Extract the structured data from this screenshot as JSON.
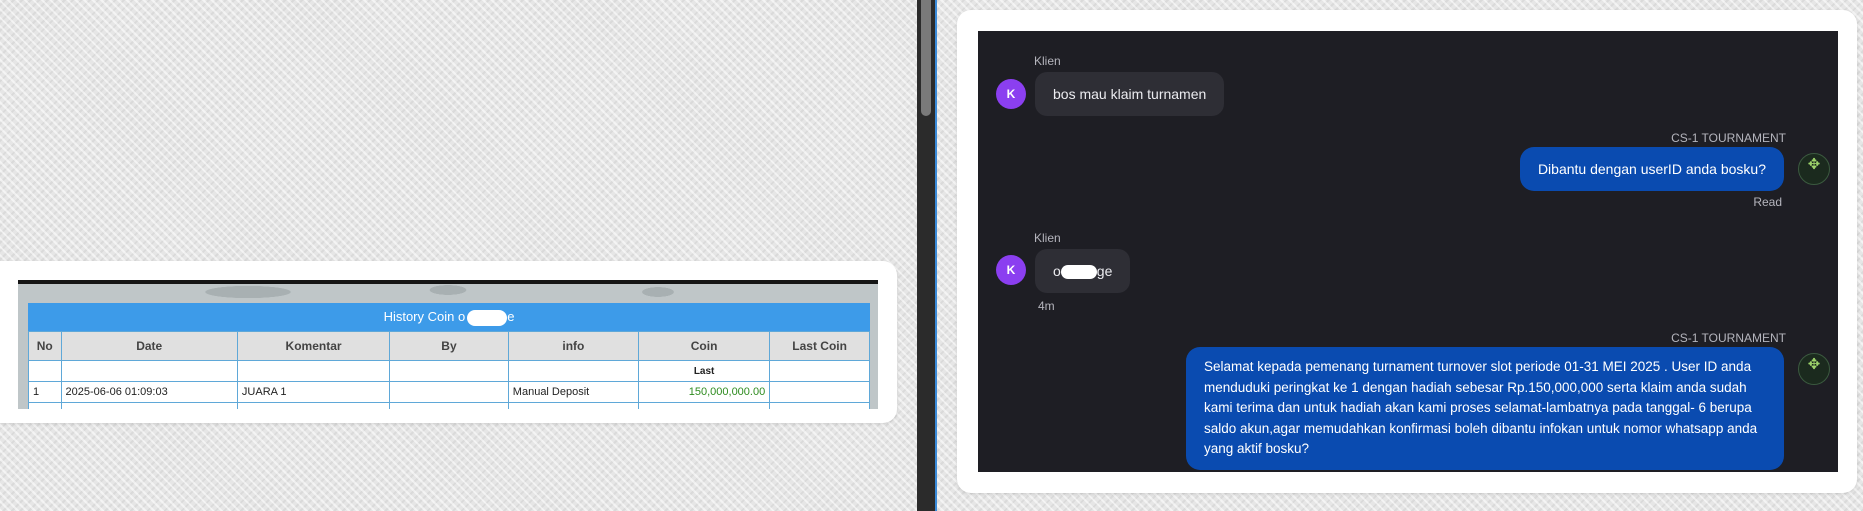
{
  "history": {
    "title_prefix": "History Coin o",
    "title_suffix": "e",
    "columns": [
      "No",
      "Date",
      "Komentar",
      "By",
      "info",
      "Coin",
      "Last Coin"
    ],
    "subheader_coin": "Last",
    "rows": [
      {
        "no": "1",
        "date": "2025-06-06 01:09:03",
        "komentar": "JUARA 1",
        "by": "",
        "info": "Manual Deposit",
        "coin": "150,000,000.00",
        "last": ""
      }
    ]
  },
  "chat": {
    "messages": [
      {
        "sender": "Klien",
        "avatar": "K",
        "text": "bos mau klaim turnamen"
      },
      {
        "sender": "CS-1 TOURNAMENT",
        "text": "Dibantu dengan userID anda bosku?",
        "status": "Read"
      },
      {
        "sender": "Klien",
        "avatar": "K",
        "text_prefix": "o",
        "text_suffix": "ge",
        "time": "4m"
      },
      {
        "sender": "CS-1 TOURNAMENT",
        "text": "Selamat kepada pemenang turnament turnover slot periode 01-31 MEI 2025 . User ID anda menduduki peringkat ke 1 dengan hadiah sebesar Rp.150,000,000 serta klaim anda sudah kami terima dan untuk hadiah akan kami proses selamat-lambatnya pada tanggal- 6 berupa saldo akun,agar memudahkan konfirmasi boleh dibantu infokan untuk nomor whatsapp anda yang aktif bosku?"
      }
    ]
  },
  "icons": {
    "bot_avatar": "tournament-logo-icon",
    "avatar_color": "#8b3ff0",
    "outgoing_bubble_color": "#0a4bb0",
    "incoming_bubble_color": "#2e2e35",
    "table_header_color": "#3d9be9",
    "coin_color": "#2e8b1f"
  }
}
